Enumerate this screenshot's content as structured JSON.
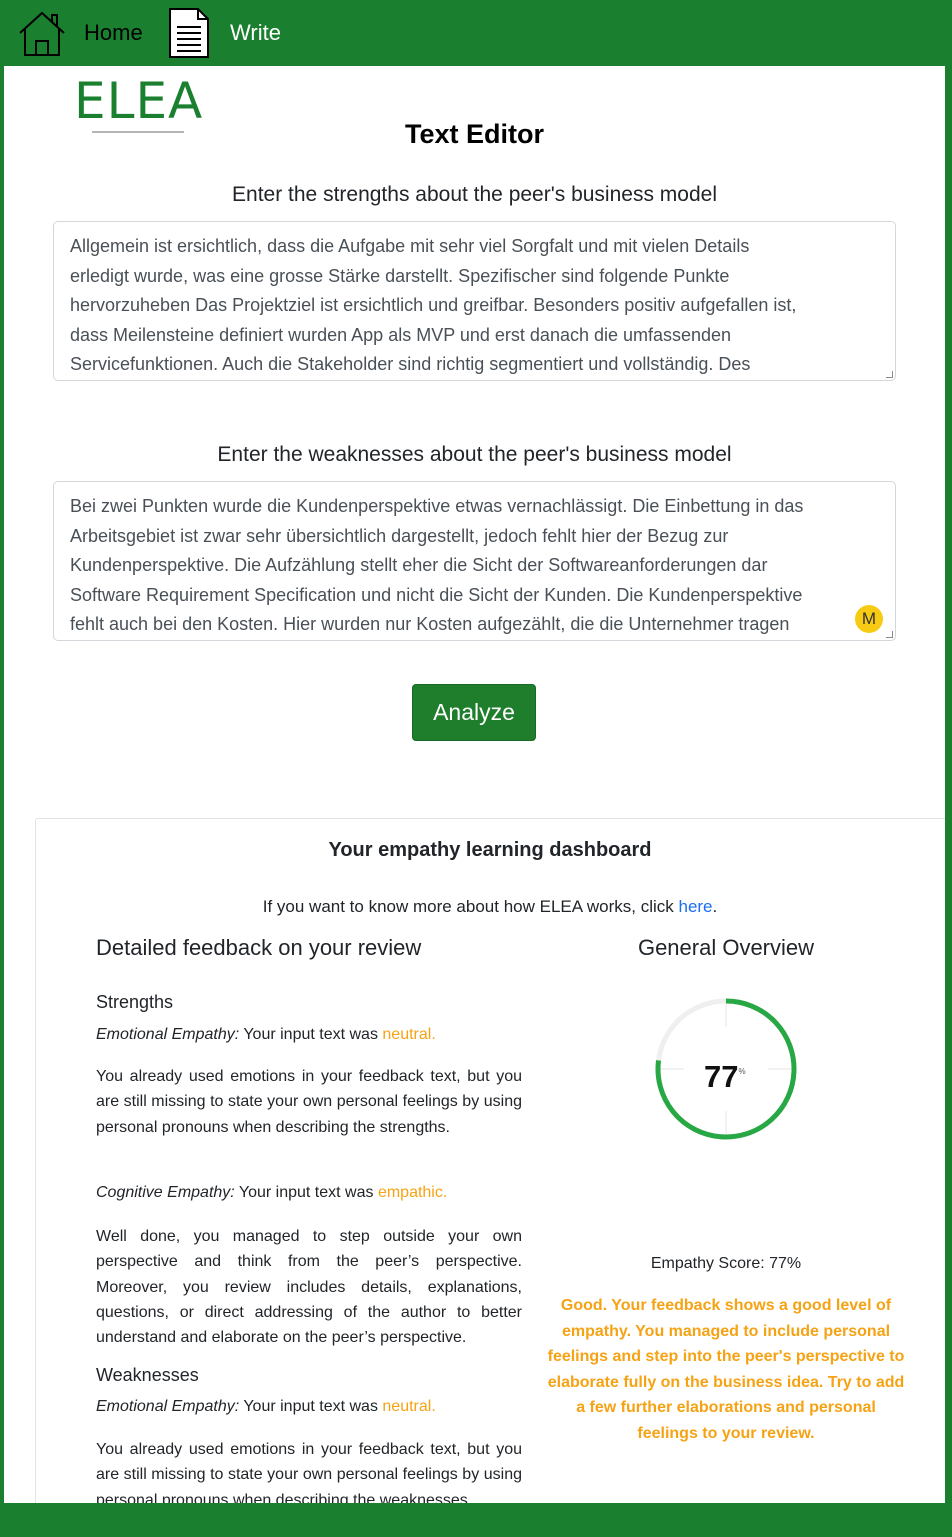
{
  "nav": {
    "home_label": "Home",
    "write_label": "Write"
  },
  "logo": {
    "text": "ELEA"
  },
  "page": {
    "title": "Text Editor"
  },
  "strengths": {
    "label": "Enter the strengths about the peer's business model",
    "lines": [
      "Allgemein ist ersichtlich, dass die Aufgabe mit sehr viel Sorgfalt und mit vielen Details",
      "erledigt wurde, was eine grosse Stärke darstellt. Spezifischer sind folgende Punkte",
      "hervorzuheben Das Projektziel ist ersichtlich und greifbar. Besonders positiv aufgefallen ist,",
      "dass Meilensteine definiert wurden App als MVP und erst danach die umfassenden",
      "Servicefunktionen. Auch die Stakeholder sind richtig segmentiert und vollständig. Des"
    ]
  },
  "weaknesses": {
    "label": "Enter the weaknesses about the peer's business model",
    "lines": [
      "Bei zwei Punkten wurde die Kundenperspektive etwas vernachlässigt. Die Einbettung in das",
      "Arbeitsgebiet ist zwar sehr übersichtlich dargestellt, jedoch fehlt hier der Bezug zur",
      "Kundenperspektive. Die Aufzählung stellt eher die Sicht der Softwareanforderungen dar",
      "Software Requirement Specification und nicht die Sicht der Kunden. Die Kundenperspektive",
      "fehlt auch bei den Kosten. Hier wurden nur Kosten aufgezählt, die die Unternehmer tragen"
    ]
  },
  "cursor": {
    "letter": "M"
  },
  "analyze_button": {
    "label": "Analyze"
  },
  "dashboard": {
    "title": "Your empathy learning dashboard",
    "info_prefix": "If you want to know more about how ELEA works, click ",
    "info_link": "here",
    "info_suffix": ".",
    "detailed": {
      "heading": "Detailed feedback on your review",
      "strengths_heading": "Strengths",
      "strengths_emotional_label": "Emotional Empathy:",
      "strengths_emotional_text": " Your input text was ",
      "strengths_emotional_value": "neutral.",
      "strengths_emotional_para": "You already used emotions in your feedback text, but you are still missing to state your own personal feelings by using personal pronouns when describing the strengths.",
      "strengths_cognitive_label": "Cognitive Empathy:",
      "strengths_cognitive_text": " Your input text was ",
      "strengths_cognitive_value": "empathic.",
      "strengths_cognitive_para": "Well done, you managed to step outside your own perspective and think from the peer’s perspective. Moreover, you review includes details, explanations, questions, or direct addressing of the author to better understand and elaborate on the peer’s perspective.",
      "weaknesses_heading": "Weaknesses",
      "weaknesses_emotional_label": "Emotional Empathy:",
      "weaknesses_emotional_text": " Your input text was ",
      "weaknesses_emotional_value": "neutral.",
      "weaknesses_emotional_para": "You already used emotions in your feedback text, but you are still missing to state your own personal feelings by using personal pronouns when describing the weaknesses."
    },
    "overview": {
      "heading": "General Overview",
      "score_value": "77",
      "score_unit": "%",
      "score_fraction": 0.77,
      "score_line": "Empathy Score: 77%",
      "summary": "Good. Your feedback shows a good level of empathy. You managed to include personal feelings and step into the peer's perspective to elaborate fully on the business idea. Try to add a few further elaborations and personal feelings to your review."
    }
  },
  "colors": {
    "brand_green": "#1a7f2e",
    "ring_green": "#28a745",
    "feedback_orange": "#f5a315",
    "link_blue": "#1b6ff2"
  },
  "icons": {
    "home": "home-icon",
    "write": "document-icon"
  }
}
